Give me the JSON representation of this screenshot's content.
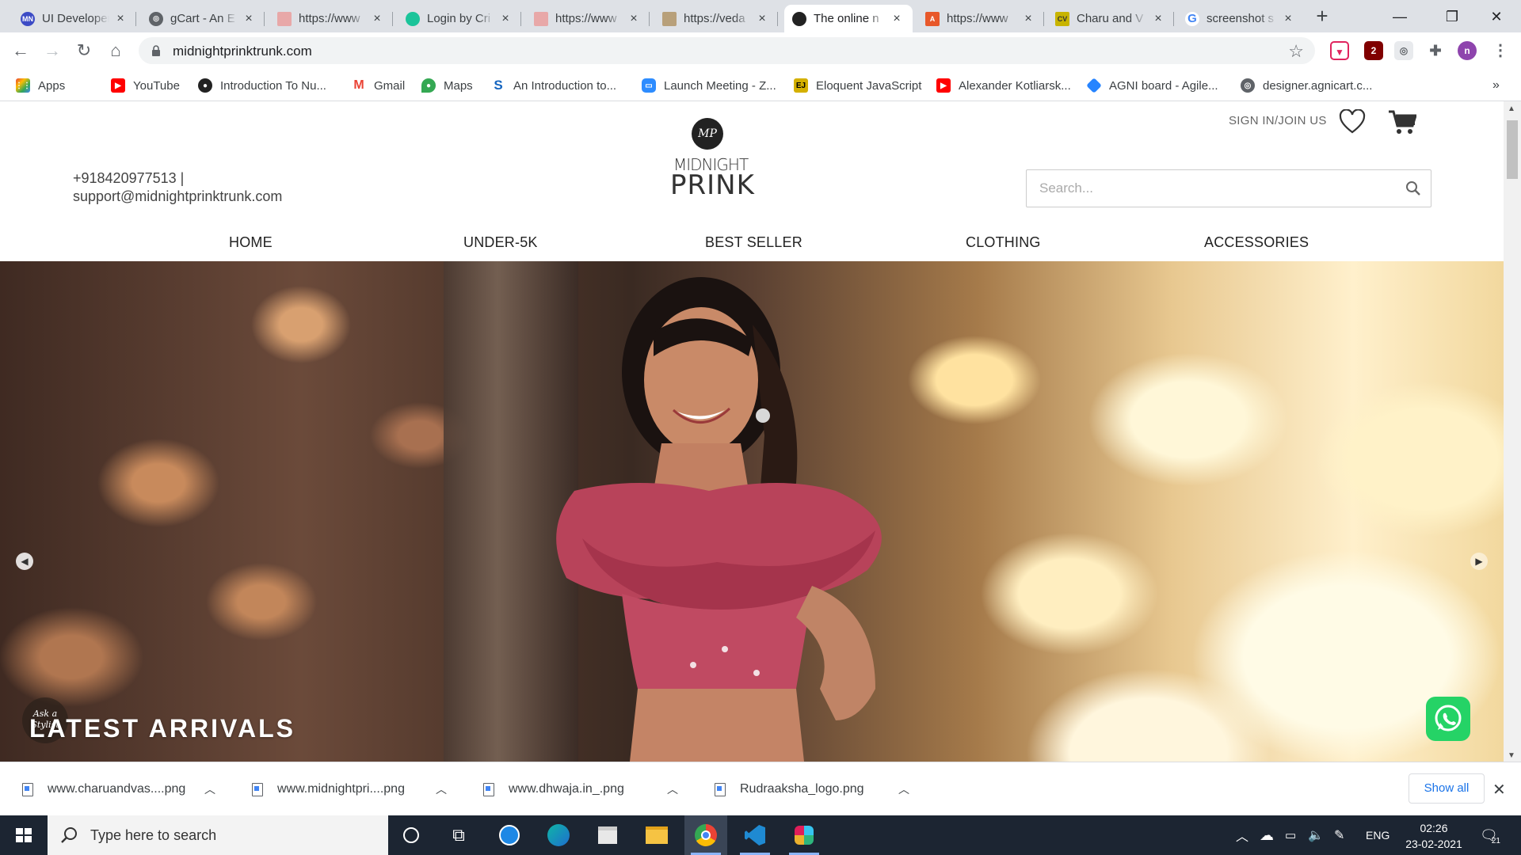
{
  "browser": {
    "tabs": [
      {
        "title": "UI Developer",
        "fav": "MN",
        "color": "#3c4bc5"
      },
      {
        "title": "gCart - An E",
        "fav": "",
        "color": "#5f6368"
      },
      {
        "title": "https://www",
        "fav": "",
        "color": "#e8a8a8"
      },
      {
        "title": "Login by Cri",
        "fav": "",
        "color": "#1bc49a"
      },
      {
        "title": "https://www",
        "fav": "",
        "color": "#e8a8a8"
      },
      {
        "title": "https://veda",
        "fav": "",
        "color": "#b8a07a"
      },
      {
        "title": "The online n",
        "fav": "",
        "color": "#222222"
      },
      {
        "title": "https://www",
        "fav": "A",
        "color": "#e8582a"
      },
      {
        "title": "Charu and V",
        "fav": "CV",
        "color": "#c8b400"
      },
      {
        "title": "screenshot s",
        "fav": "G",
        "color": "#4285f4"
      }
    ],
    "active_tab": 6,
    "url": "midnightprinktrunk.com",
    "bookmarks": [
      {
        "label": "Apps",
        "color": "#ea4335",
        "glyph": "⋮"
      },
      {
        "label": "YouTube",
        "color": "#ff0000",
        "glyph": "▶"
      },
      {
        "label": "Introduction To Nu...",
        "color": "#222222",
        "glyph": "●"
      },
      {
        "label": "Gmail",
        "color": "#ea4335",
        "glyph": "M"
      },
      {
        "label": "Maps",
        "color": "#34a853",
        "glyph": "◆"
      },
      {
        "label": "An Introduction to...",
        "color": "#1565c0",
        "glyph": "S"
      },
      {
        "label": "Launch Meeting - Z...",
        "color": "#2d8cff",
        "glyph": "▭"
      },
      {
        "label": "Eloquent JavaScript",
        "color": "#d4b000",
        "glyph": "EJ"
      },
      {
        "label": "Alexander Kotliarsk...",
        "color": "#ff0000",
        "glyph": "▶"
      },
      {
        "label": "AGNI board - Agile...",
        "color": "#2684ff",
        "glyph": "◆"
      },
      {
        "label": "designer.agnicart.c...",
        "color": "#5f6368",
        "glyph": "◎"
      }
    ]
  },
  "site": {
    "logo_line1": "MIDNIGHT",
    "logo_line2": "PRINK",
    "logo_mark": "MP",
    "phone": "+918420977513 |",
    "email": "support@midnightprinktrunk.com",
    "signin": "SIGN IN/JOIN US",
    "search_placeholder": "Search...",
    "menu": [
      "HOME",
      "UNDER-5K",
      "BEST SELLER",
      "CLOTHING",
      "ACCESSORIES"
    ],
    "hero_title": "LATEST ARRIVALS",
    "ask_badge": "Ask a Stylist"
  },
  "downloads": {
    "items": [
      "www.charuandvas....png",
      "www.midnightpri....png",
      "www.dhwaja.in_.png",
      "Rudraaksha_logo.png"
    ],
    "show_all": "Show all"
  },
  "taskbar": {
    "search_placeholder": "Type here to search",
    "language": "ENG",
    "time": "02:26",
    "date": "23-02-2021",
    "notifications": "21"
  }
}
